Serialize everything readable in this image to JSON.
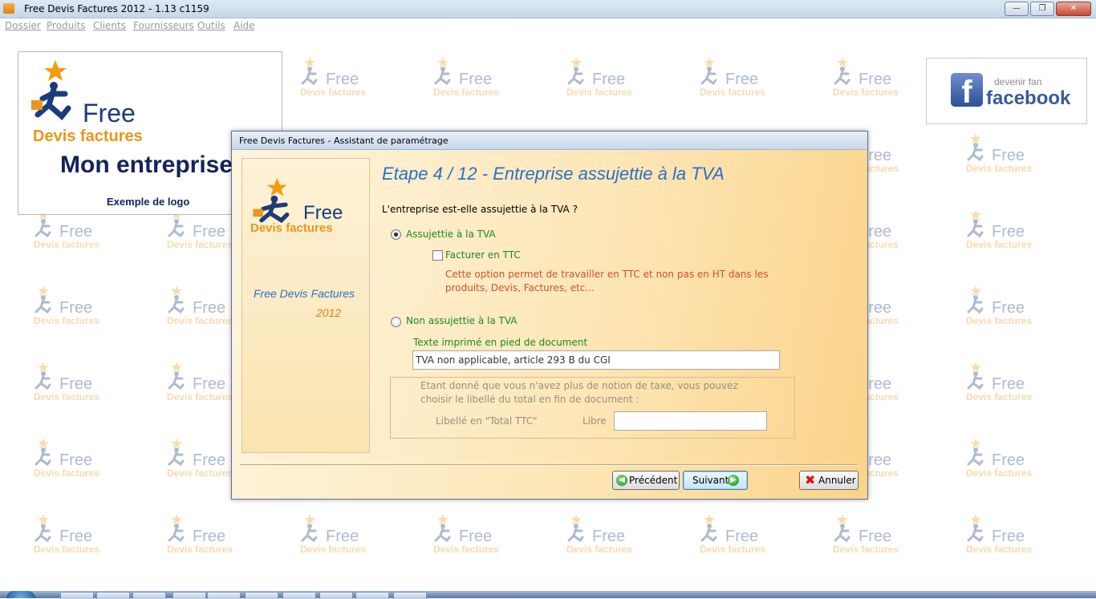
{
  "window": {
    "title": "Free Devis Factures 2012 - 1.13 c1159",
    "minimize_icon": "minimize-icon",
    "maximize_icon": "restore-icon",
    "close_icon": "close-icon"
  },
  "menu": {
    "items": [
      "Dossier",
      "Produits",
      "Clients",
      "Fournisseurs",
      "Outils",
      "Aide"
    ]
  },
  "watermark": {
    "word": "Free",
    "sub": "Devis factures"
  },
  "logo_panel": {
    "free": "Free",
    "sub": "Devis factures",
    "company": "Mon entreprise",
    "caption": "Exemple de logo"
  },
  "facebook": {
    "top": "devenir fan",
    "word": "facebook",
    "letter": "f"
  },
  "dialog": {
    "title": "Free Devis Factures - Assistant de paramétrage",
    "pane_app_name": "Free Devis Factures",
    "pane_year": "2012",
    "logo_free": "Free",
    "logo_sub": "Devis factures",
    "step_title": "Etape 4 / 12 - Entreprise assujettie à la TVA",
    "question": "L'entreprise est-elle assujettie à la TVA ?",
    "option_subject": "Assujettie à la TVA",
    "option_subject_checked": true,
    "checkbox_ttc": "Facturer en TTC",
    "checkbox_ttc_checked": false,
    "ttc_help_line1": "Cette option permet de travailler en TTC et non pas en HT dans les",
    "ttc_help_line2": "produits, Devis, Factures, etc...",
    "option_not_subject": "Non assujettie à la TVA",
    "option_not_subject_checked": false,
    "footer_text_label": "Texte imprimé en pied de document",
    "footer_text_value": "TVA non applicable, article 293 B du CGI",
    "tax_note_line1": "Etant donné que vous n'avez plus de notion de taxe, vous pouvez",
    "tax_note_line2": "choisir le libellé du total en fin de document :",
    "total_label": "Libellé en \"Total TTC\"",
    "free_label": "Libre",
    "free_value": "",
    "btn_previous": "Précédent",
    "btn_next": "Suivant",
    "btn_cancel": "Annuler"
  },
  "colors": {
    "accent_blue": "#2b6fc6",
    "green_label": "#1e8a1e",
    "help_red": "#d1512a",
    "logo_orange": "#e8961c",
    "logo_navy": "#1a3c7a"
  }
}
